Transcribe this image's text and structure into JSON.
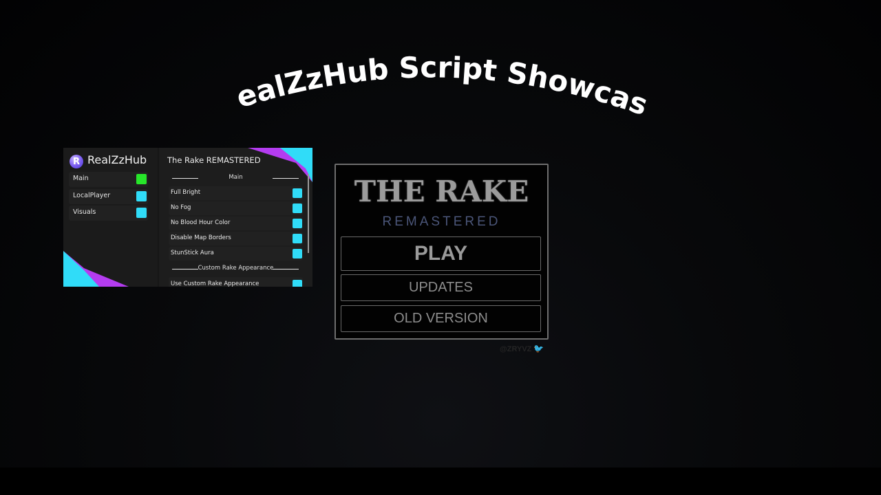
{
  "video_title": "RealZzHub Script Showcase",
  "hub": {
    "brand": "RealZzHub",
    "logo_letter": "R",
    "tabs": [
      {
        "label": "Main",
        "color": "#27e62a"
      },
      {
        "label": "LocalPlayer",
        "color": "#30dcf8"
      },
      {
        "label": "Visuals",
        "color": "#30dcf8"
      }
    ],
    "game_title": "The Rake REMASTERED",
    "sections": [
      {
        "title": "Main"
      },
      {
        "title": "Custom Rake Appearance"
      }
    ],
    "options": [
      {
        "label": "Full Bright"
      },
      {
        "label": "No Fog"
      },
      {
        "label": "No Blood Hour Color"
      },
      {
        "label": "Disable Map Borders"
      },
      {
        "label": "StunStick Aura"
      },
      {
        "label": "Use Custom Rake Appearance"
      }
    ],
    "accent_cyan": "#30dcf8",
    "accent_purple": "#b43cf0"
  },
  "game_menu": {
    "title": "THE RAKE",
    "subtitle": "REMASTERED",
    "buttons": {
      "play": "PLAY",
      "updates": "UPDATES",
      "old_version": "OLD VERSION"
    }
  },
  "watermark": {
    "handle": "@ZRYVZ",
    "icon": "twitter-bird-icon"
  }
}
